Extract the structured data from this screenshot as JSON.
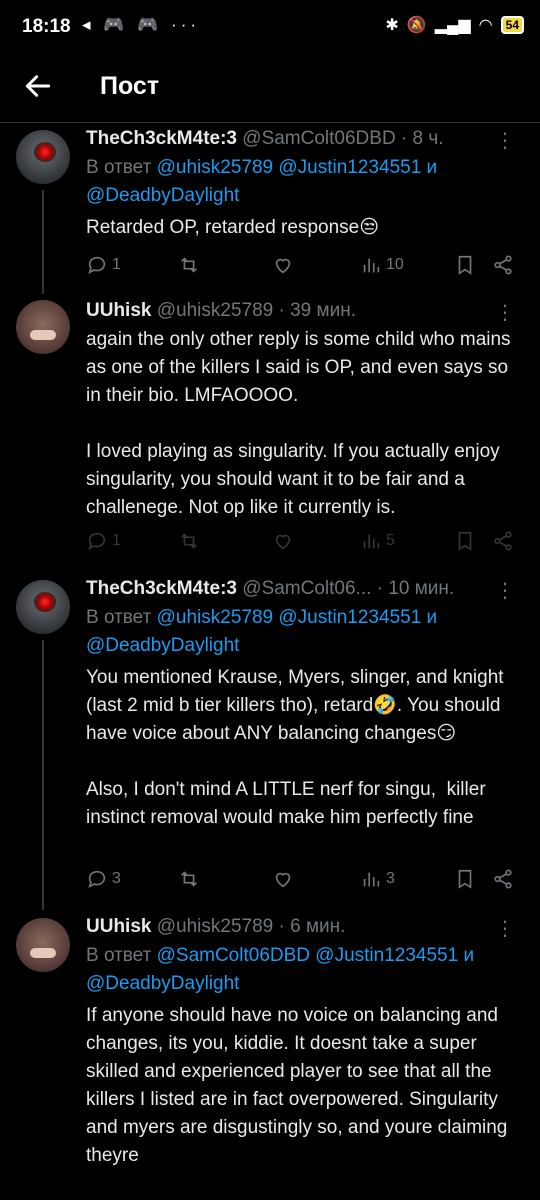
{
  "status": {
    "time": "18:18",
    "left_icons": "◂ 🎮 🎮 ···",
    "battery": "54"
  },
  "header": {
    "title": "Пост"
  },
  "tweets": [
    {
      "name": "TheCh3ckM4te:3",
      "handle": "@SamColt06DBD · 8 ч.",
      "reply_prefix": "В ответ",
      "reply_links": [
        "@uhisk25789",
        "@Justin1234551",
        "@DeadbyDaylight"
      ],
      "reply_and": "и",
      "text": "Retarded OP, retarded response😒",
      "replies": "1",
      "views": "10"
    },
    {
      "name": "UUhisk",
      "handle": "@uhisk25789 · 39 мин.",
      "text": "again the only other reply is some child who mains as one of the killers I said is OP, and even says so in their bio. LMFAOOOO.\n\nI loved playing as singularity. If you actually enjoy singularity, you should want it to be fair and a challenege. Not op like it currently is.",
      "replies": "1",
      "views": "5"
    },
    {
      "name": "TheCh3ckM4te:3",
      "handle": "@SamColt06... · 10 мин.",
      "reply_prefix": "В ответ",
      "reply_links": [
        "@uhisk25789",
        "@Justin1234551",
        "@DeadbyDaylight"
      ],
      "reply_and": "и",
      "text": "You mentioned Krause, Myers, slinger, and knight (last 2 mid b tier killers tho), retard🤣. You should have voice about ANY balancing changes😏\n\nAlso, I don't mind A LITTLE nerf for singu,  killer instinct removal would make him perfectly fine",
      "replies": "3",
      "views": "3"
    },
    {
      "name": "UUhisk",
      "handle": "@uhisk25789 · 6 мин.",
      "reply_prefix": "В ответ",
      "reply_links": [
        "@SamColt06DBD",
        "@Justin1234551",
        "@DeadbyDaylight"
      ],
      "reply_and": "и",
      "text": "If anyone should have no voice on balancing and changes, its you, kiddie. It doesnt take a super skilled and experienced player to see that all the killers I listed are in fact overpowered. Singularity and myers are disgustingly so, and youre claiming theyre"
    }
  ]
}
